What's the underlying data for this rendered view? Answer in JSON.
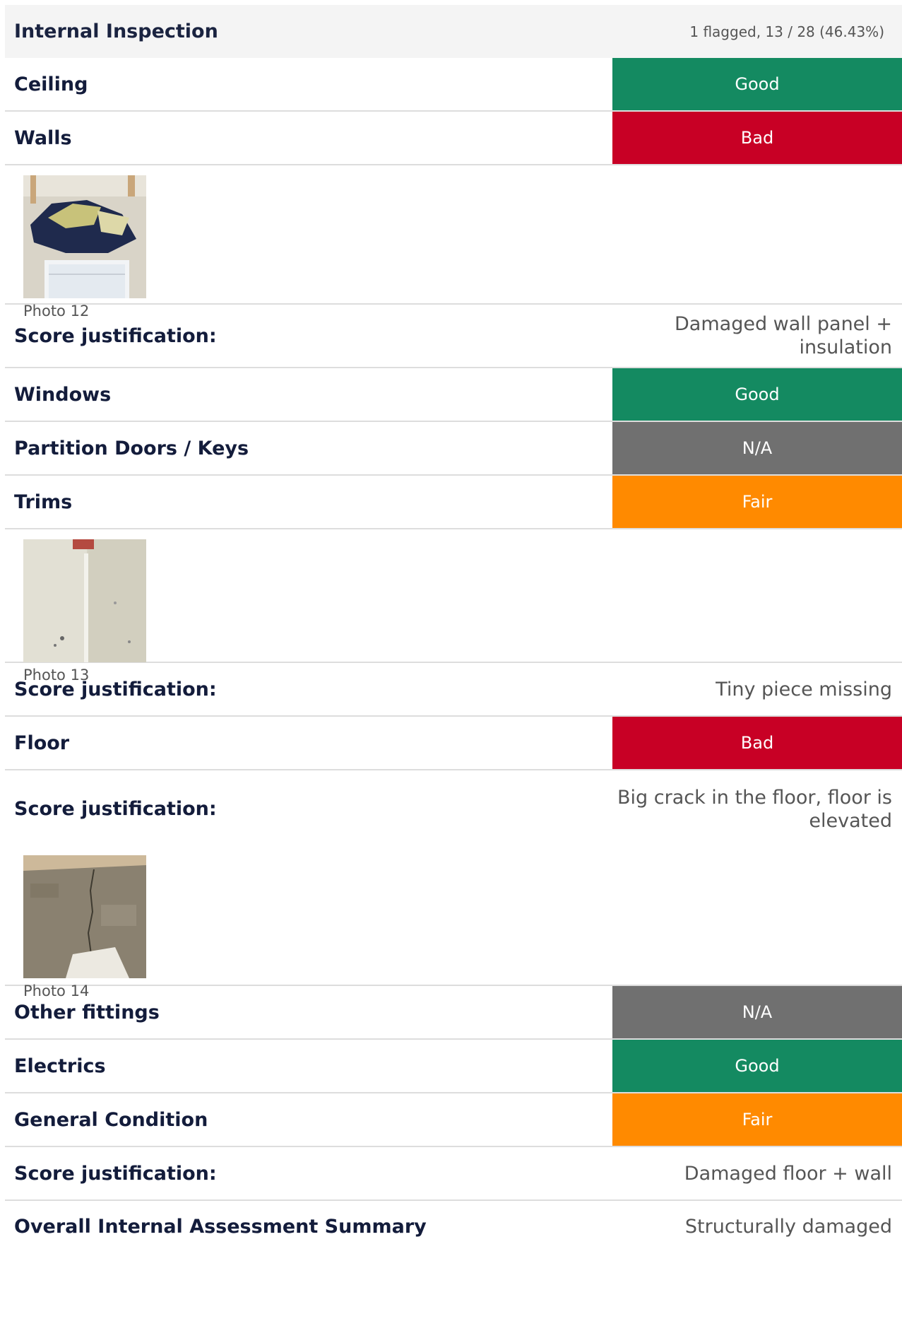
{
  "section": {
    "title": "Internal Inspection",
    "stats": "1 flagged, 13 / 28 (46.43%)"
  },
  "colors": {
    "Good": "#148a61",
    "Bad": "#c80025",
    "N/A": "#707070",
    "Fair": "#ff8a00"
  },
  "items": {
    "ceiling": {
      "label": "Ceiling",
      "rating": "Good"
    },
    "walls": {
      "label": "Walls",
      "rating": "Bad",
      "photo_caption": "Photo 12",
      "justification_label": "Score justification:",
      "justification": "Damaged wall panel + insulation"
    },
    "windows": {
      "label": "Windows",
      "rating": "Good"
    },
    "doors": {
      "label": "Partition Doors / Keys",
      "rating": "N/A"
    },
    "trims": {
      "label": "Trims",
      "rating": "Fair",
      "photo_caption": "Photo 13",
      "justification_label": "Score justification:",
      "justification": "Tiny piece missing"
    },
    "floor": {
      "label": "Floor",
      "rating": "Bad",
      "justification_label": "Score justification:",
      "justification": "Big crack in the floor, floor is elevated",
      "photo_caption": "Photo 14"
    },
    "fittings": {
      "label": "Other fittings",
      "rating": "N/A"
    },
    "electrics": {
      "label": "Electrics",
      "rating": "Good"
    },
    "general": {
      "label": "General Condition",
      "rating": "Fair",
      "justification_label": "Score justification:",
      "justification": "Damaged floor + wall"
    }
  },
  "summary": {
    "label": "Overall Internal Assessment Summary",
    "value": "Structurally damaged"
  }
}
